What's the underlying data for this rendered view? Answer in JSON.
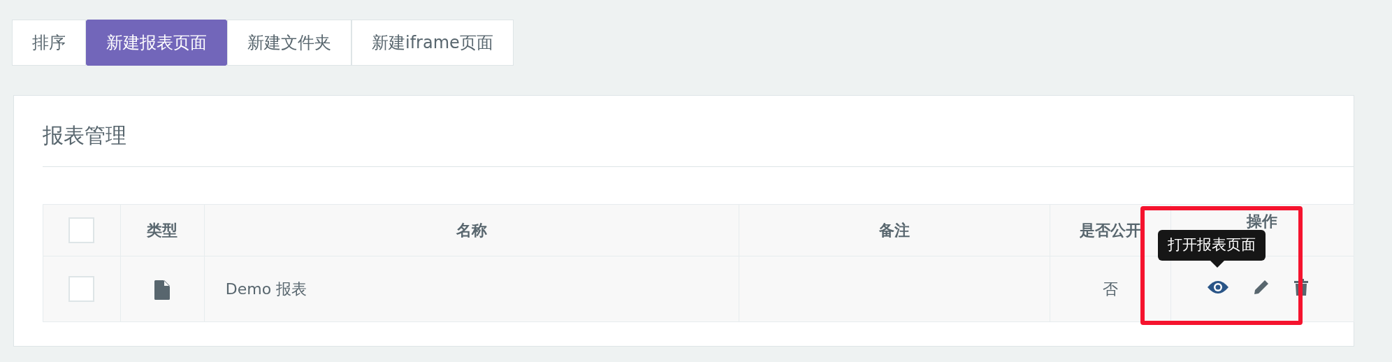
{
  "toolbar": [
    {
      "label": "排序",
      "selected": false
    },
    {
      "label": "新建报表页面",
      "selected": true
    },
    {
      "label": "新建文件夹",
      "selected": false
    },
    {
      "label": "新建iframe页面",
      "selected": false
    }
  ],
  "panel": {
    "title": "报表管理"
  },
  "table": {
    "columns": [
      "类型",
      "名称",
      "备注",
      "是否公开",
      "操作"
    ],
    "rows": [
      {
        "checked": false,
        "kind": "file",
        "name": "Demo 报表",
        "public": "否"
      }
    ]
  },
  "header_checkbox": {
    "checked": false
  },
  "tooltip": {
    "text": "打开报表页面"
  },
  "highlight": {
    "kind": "frame",
    "color": "#f5132e"
  }
}
